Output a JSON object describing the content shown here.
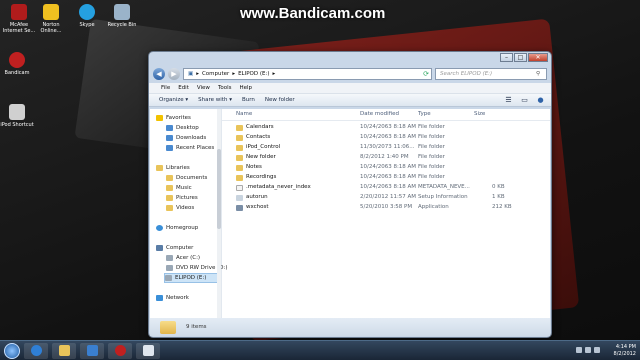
{
  "watermark": "www.Bandicam.com",
  "desktop_icons": [
    {
      "label": "McAfee Internet Se...",
      "icon": "mcafee-icon",
      "color": "#b01c1c"
    },
    {
      "label": "Norton Online...",
      "icon": "norton-icon",
      "color": "#f0c020"
    },
    {
      "label": "Skype",
      "icon": "skype-icon",
      "color": "#25a0e0"
    },
    {
      "label": "Recycle Bin",
      "icon": "recycle-bin-icon",
      "color": "#9ab3c9"
    },
    {
      "label": "Bandicam",
      "icon": "bandicam-icon",
      "color": "#c02020"
    },
    {
      "label": "iPod Shortcut",
      "icon": "shortcut-icon",
      "color": "#d0d0d0"
    }
  ],
  "address": {
    "segments": [
      "Computer",
      "ELIPOD (E:)"
    ]
  },
  "search": {
    "placeholder": "Search ELIPOD (E:)"
  },
  "menu": [
    "File",
    "Edit",
    "View",
    "Tools",
    "Help"
  ],
  "toolbar": [
    "Organize",
    "Share with",
    "Burn",
    "New folder"
  ],
  "nav": {
    "favorites": "Favorites",
    "fav_items": [
      "Desktop",
      "Downloads",
      "Recent Places"
    ],
    "libraries": "Libraries",
    "lib_items": [
      "Documents",
      "Music",
      "Pictures",
      "Videos"
    ],
    "homegroup": "Homegroup",
    "computer": "Computer",
    "comp_items": [
      "Acer (C:)",
      "DVD RW Drive (D:)",
      "ELIPOD (E:)"
    ],
    "network": "Network"
  },
  "columns": [
    "Name",
    "Date modified",
    "Type",
    "Size"
  ],
  "files": [
    {
      "name": "Calendars",
      "date": "10/24/2063 8:18 AM",
      "type": "File folder",
      "size": "",
      "kind": "folder"
    },
    {
      "name": "Contacts",
      "date": "10/24/2063 8:18 AM",
      "type": "File folder",
      "size": "",
      "kind": "folder"
    },
    {
      "name": "iPod_Control",
      "date": "11/30/2073 11:06...",
      "type": "File folder",
      "size": "",
      "kind": "folder"
    },
    {
      "name": "New folder",
      "date": "8/2/2012 1:40 PM",
      "type": "File folder",
      "size": "",
      "kind": "folder"
    },
    {
      "name": "Notes",
      "date": "10/24/2063 8:18 AM",
      "type": "File folder",
      "size": "",
      "kind": "folder"
    },
    {
      "name": "Recordings",
      "date": "10/24/2063 8:18 AM",
      "type": "File folder",
      "size": "",
      "kind": "folder"
    },
    {
      "name": ".metadata_never_index",
      "date": "10/24/2063 8:18 AM",
      "type": "METADATA_NEVE...",
      "size": "0 KB",
      "kind": "file"
    },
    {
      "name": "autorun",
      "date": "2/20/2012 11:57 AM",
      "type": "Setup Information",
      "size": "1 KB",
      "kind": "setup"
    },
    {
      "name": "wxchost",
      "date": "5/20/2010 3:58 PM",
      "type": "Application",
      "size": "212 KB",
      "kind": "app"
    }
  ],
  "status": {
    "item_count": "9 items"
  },
  "clock": {
    "time": "4:14 PM",
    "date": "8/2/2012"
  }
}
